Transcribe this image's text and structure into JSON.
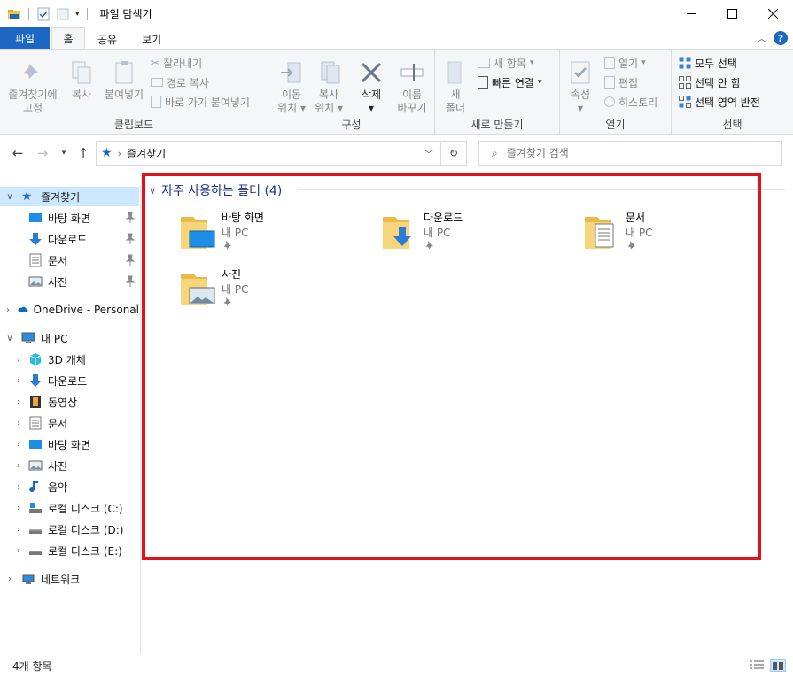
{
  "window": {
    "title": "파일 탐색기"
  },
  "ribbon_tabs": [
    {
      "label": "파일"
    },
    {
      "label": "홈"
    },
    {
      "label": "공유"
    },
    {
      "label": "보기"
    }
  ],
  "ribbon": {
    "clipboard": {
      "label": "클립보드",
      "pin_quick_line1": "즐겨찾기에",
      "pin_quick_line2": "고정",
      "copy": "복사",
      "paste": "붙여넣기",
      "cut": "잘라내기",
      "copy_path": "경로 복사",
      "paste_shortcut": "바로 가기 붙여넣기"
    },
    "organize": {
      "label": "구성",
      "move_to_line1": "이동",
      "move_to_line2": "위치",
      "copy_to_line1": "복사",
      "copy_to_line2": "위치",
      "delete": "삭제",
      "rename_line1": "이름",
      "rename_line2": "바꾸기"
    },
    "new": {
      "label": "새로 만들기",
      "new_folder_line1": "새",
      "new_folder_line2": "폴더",
      "new_item": "새 항목",
      "easy_access": "빠른 연결"
    },
    "open": {
      "label": "열기",
      "properties": "속성",
      "open": "열기",
      "edit": "편집",
      "history": "히스토리"
    },
    "select": {
      "label": "선택",
      "select_all": "모두 선택",
      "select_none": "선택 안 함",
      "invert_selection": "선택 영역 반전"
    }
  },
  "address_bar": {
    "path": "즐겨찾기",
    "search_placeholder": "즐겨찾기 검색"
  },
  "nav_pane": {
    "quick_access": "즐겨찾기",
    "quick_items": [
      {
        "label": "바탕 화면"
      },
      {
        "label": "다운로드"
      },
      {
        "label": "문서"
      },
      {
        "label": "사진"
      }
    ],
    "onedrive": "OneDrive - Personal",
    "this_pc": "내 PC",
    "pc_items": [
      {
        "label": "3D 개체"
      },
      {
        "label": "다운로드"
      },
      {
        "label": "동영상"
      },
      {
        "label": "문서"
      },
      {
        "label": "바탕 화면"
      },
      {
        "label": "사진"
      },
      {
        "label": "음악"
      },
      {
        "label": "로컬 디스크 (C:)"
      },
      {
        "label": "로컬 디스크 (D:)"
      },
      {
        "label": "로컬 디스크 (E:)"
      }
    ],
    "network": "네트워크"
  },
  "content": {
    "group_header": "자주 사용하는 폴더 (4)",
    "folders": [
      {
        "name": "바탕 화면",
        "location": "내 PC"
      },
      {
        "name": "다운로드",
        "location": "내 PC"
      },
      {
        "name": "문서",
        "location": "내 PC"
      },
      {
        "name": "사진",
        "location": "내 PC"
      }
    ]
  },
  "status_bar": {
    "item_count": "4개 항목"
  },
  "colors": {
    "accent": "#1c67c4",
    "selection": "#cce8ff",
    "highlight_box": "#e3101e",
    "group_header": "#1e3287"
  }
}
